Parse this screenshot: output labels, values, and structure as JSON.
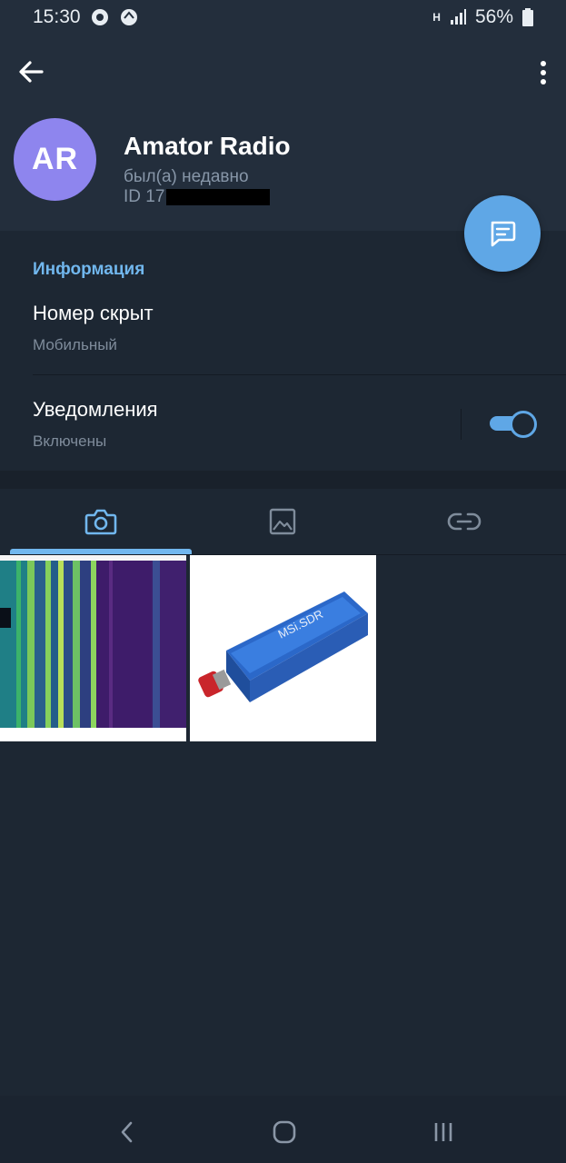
{
  "status_bar": {
    "time": "15:30",
    "network": "H",
    "battery": "56%"
  },
  "profile": {
    "initials": "AR",
    "name": "Amator Radio",
    "last_seen": "был(а) недавно",
    "id_prefix": "ID 17",
    "avatar_color": "#8e85ee"
  },
  "info": {
    "title": "Информация",
    "phone": "Номер скрыт",
    "phone_label": "Мобильный",
    "notifications": "Уведомления",
    "notifications_state": "Включены",
    "notifications_on": true
  },
  "tabs": [
    {
      "icon": "camera-icon",
      "active": true
    },
    {
      "icon": "image-icon",
      "active": false
    },
    {
      "icon": "link-icon",
      "active": false
    }
  ],
  "media": [
    {
      "kind": "spectrum-waterfall-photo"
    },
    {
      "kind": "sdr-device-photo",
      "label": "MSi.SDR"
    }
  ],
  "colors": {
    "header_bg": "#232e3c",
    "page_bg": "#1d2733",
    "accent": "#5fa7e6",
    "section_title": "#71b7ee"
  }
}
